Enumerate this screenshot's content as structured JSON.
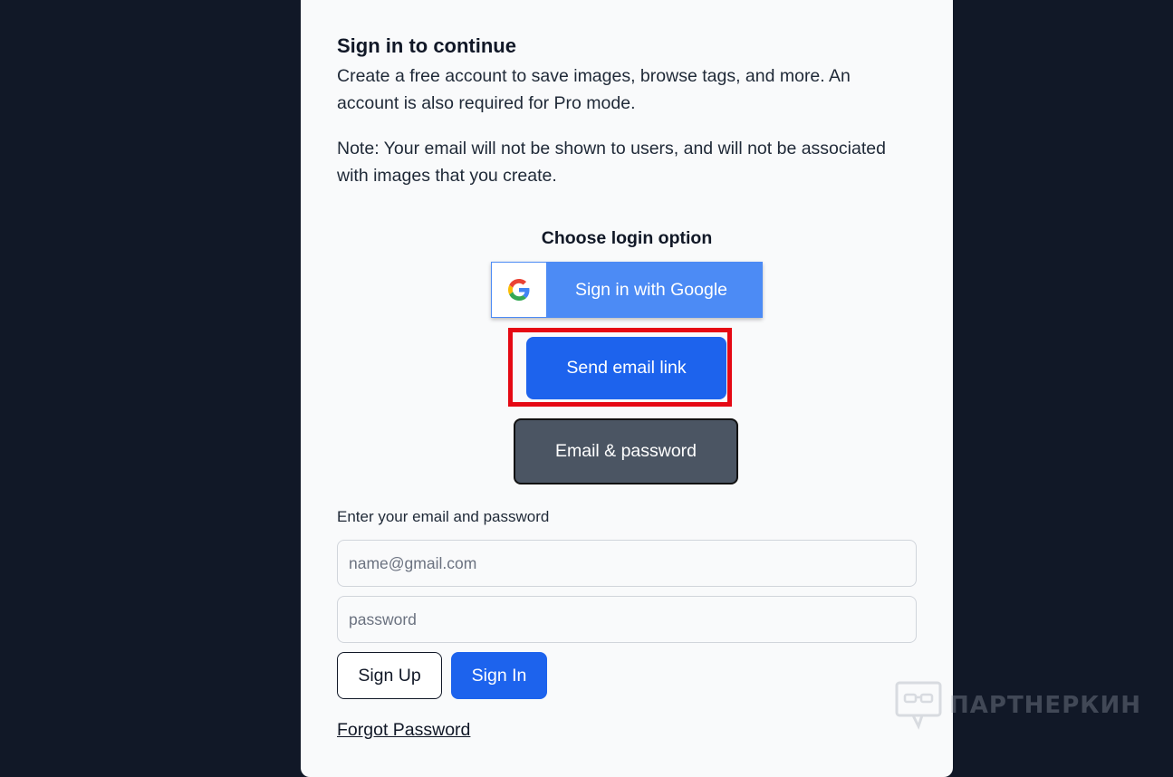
{
  "auth": {
    "title": "Sign in to continue",
    "description": "Create a free account to save images, browse tags, and more. An account is also required for Pro mode.",
    "note": "Note: Your email will not be shown to users, and will not be associated with images that you create.",
    "choose_label": "Choose login option",
    "google_button_label": "Sign in with Google",
    "email_link_button_label": "Send email link",
    "email_password_button_label": "Email & password"
  },
  "form": {
    "label": "Enter your email and password",
    "email_placeholder": "name@gmail.com",
    "password_placeholder": "password",
    "signup_label": "Sign Up",
    "signin_label": "Sign In",
    "forgot_label": "Forgot Password"
  },
  "watermark": {
    "text": "ПАРТНЕРКИН"
  },
  "colors": {
    "background": "#111827",
    "card": "#f9fafb",
    "primary": "#1d63ed",
    "google": "#4c8bf5",
    "secondary": "#4b5563",
    "highlight": "#e50914"
  },
  "icons": {
    "google": "google-g-icon",
    "watermark": "chat-glasses-icon"
  }
}
